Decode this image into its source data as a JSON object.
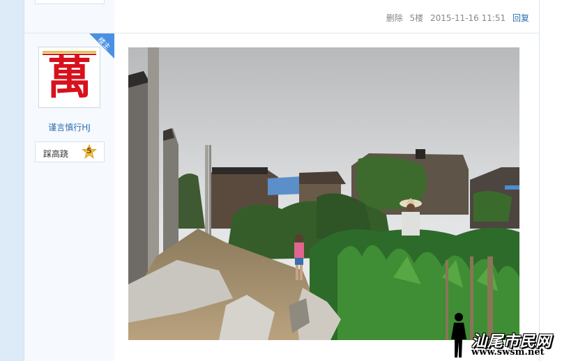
{
  "previous_post": {
    "meta": {
      "delete_label": "删除",
      "floor": "5楼",
      "timestamp": "2015-11-16 11:51",
      "reply_label": "回复"
    }
  },
  "post": {
    "author": {
      "badge": "楼主",
      "name": "谨言慎行HJ",
      "rank_title": "踩高跷",
      "rank_level": "5",
      "avatar_char": "萬"
    },
    "image": {
      "kind": "photo",
      "scene": "village-alley"
    }
  },
  "watermark": {
    "title": "汕尾市民网",
    "url": "www.swsm.net"
  },
  "colors": {
    "link": "#2a6cb5",
    "badge": "#4a90e2",
    "seal_red": "#d8111c",
    "page_bg": "#e3eef8"
  }
}
